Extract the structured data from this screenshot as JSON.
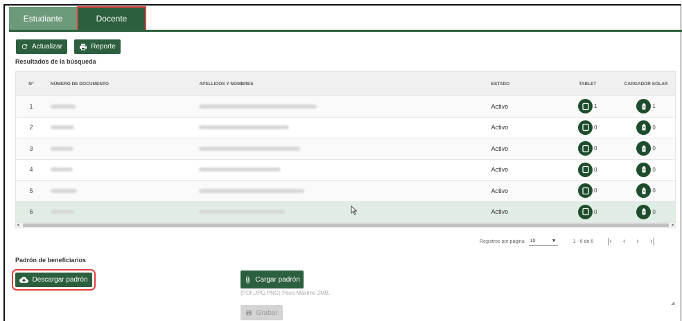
{
  "tabs": [
    {
      "label": "Estudiante",
      "active": false
    },
    {
      "label": "Docente",
      "active": true
    }
  ],
  "toolbar": {
    "refresh_label": "Actualizar",
    "report_label": "Reporte"
  },
  "results_title": "Resultados de la búsqueda",
  "table": {
    "headers": [
      "N°",
      "NÚMERO DE DOCUMENTO",
      "APELLIDOS Y NOMBRES",
      "ESTADO",
      "TABLET",
      "CARGADOR SOLAR"
    ],
    "rows": [
      {
        "n": "1",
        "estado": "Activo",
        "tablet": "1",
        "solar": "1"
      },
      {
        "n": "2",
        "estado": "Activo",
        "tablet": "0",
        "solar": "0"
      },
      {
        "n": "3",
        "estado": "Activo",
        "tablet": "0",
        "solar": "0"
      },
      {
        "n": "4",
        "estado": "Activo",
        "tablet": "0",
        "solar": "0"
      },
      {
        "n": "5",
        "estado": "Activo",
        "tablet": "0",
        "solar": "0"
      },
      {
        "n": "6",
        "estado": "Activo",
        "tablet": "0",
        "solar": "0"
      }
    ]
  },
  "paginator": {
    "label": "Registros por página",
    "page_size": "10",
    "range": "1 - 6 de 6"
  },
  "padron": {
    "title": "Padrón de beneficiarios",
    "download_label": "Descargar padrón",
    "upload_label": "Cargar padrón",
    "hint": "(PDF,JPG,PNG) Peso Máximo 2MB.",
    "save_label": "Grabar"
  },
  "colors": {
    "primary": "#2c5f3d",
    "tab_inactive": "#6d9a7a",
    "highlight": "#e0403f",
    "selected_row": "#e0ede4"
  },
  "icons": [
    "refresh-icon",
    "print-icon",
    "tablet-icon",
    "solar-charger-icon",
    "cloud-download-icon",
    "paperclip-icon",
    "save-icon"
  ]
}
